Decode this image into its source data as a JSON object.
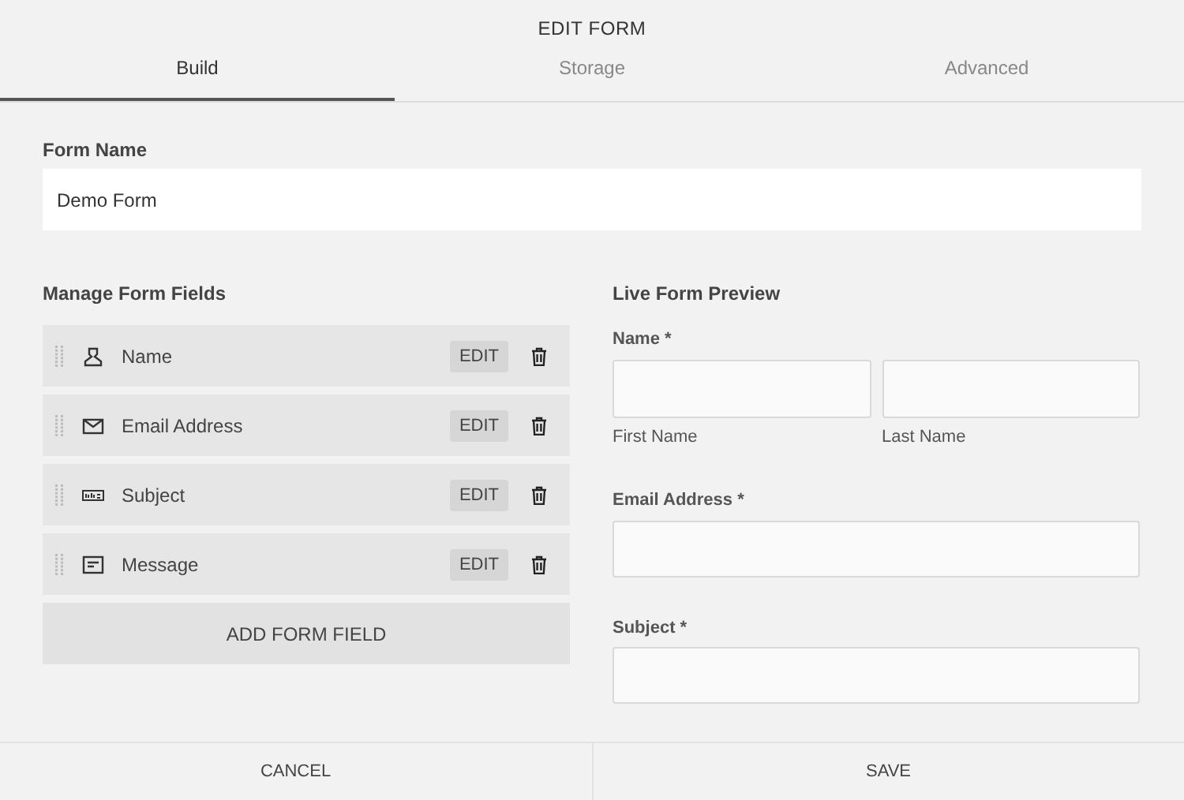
{
  "title": "EDIT FORM",
  "tabs": [
    {
      "label": "Build",
      "selected": true
    },
    {
      "label": "Storage",
      "selected": false
    },
    {
      "label": "Advanced",
      "selected": false
    }
  ],
  "form_name": {
    "label": "Form Name",
    "value": "Demo Form"
  },
  "manage": {
    "heading": "Manage Form Fields",
    "fields": [
      {
        "kind": "name",
        "label": "Name",
        "edit": "EDIT"
      },
      {
        "kind": "email",
        "label": "Email Address",
        "edit": "EDIT"
      },
      {
        "kind": "text",
        "label": "Subject",
        "edit": "EDIT"
      },
      {
        "kind": "textarea",
        "label": "Message",
        "edit": "EDIT"
      }
    ],
    "add_button": "ADD FORM FIELD"
  },
  "preview": {
    "heading": "Live Form Preview",
    "fields": [
      {
        "kind": "name",
        "label": "Name *",
        "sublabels": [
          "First Name",
          "Last Name"
        ]
      },
      {
        "kind": "single",
        "label": "Email Address *"
      },
      {
        "kind": "single",
        "label": "Subject *"
      }
    ]
  },
  "footer": [
    "CANCEL",
    "SAVE"
  ]
}
